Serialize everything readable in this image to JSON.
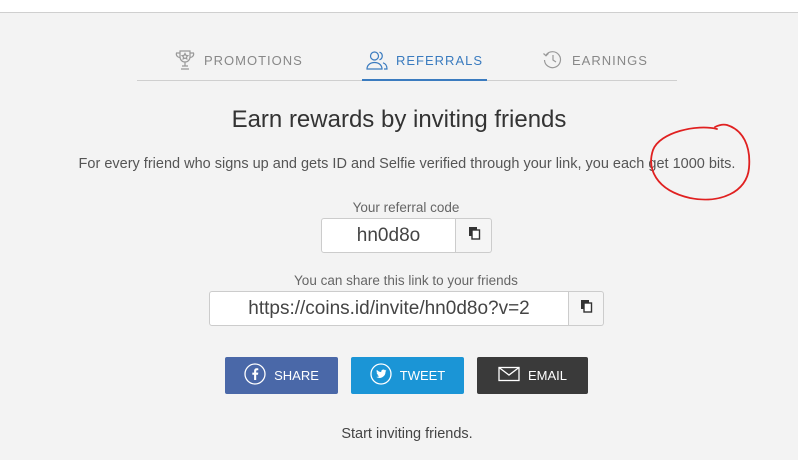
{
  "tabs": [
    {
      "label": "PROMOTIONS",
      "icon": "trophy-icon"
    },
    {
      "label": "REFERRALS",
      "icon": "users-icon",
      "active": true
    },
    {
      "label": "EARNINGS",
      "icon": "history-icon"
    }
  ],
  "main": {
    "title": "Earn rewards by inviting friends",
    "description": "For every friend who signs up and gets ID and Selfie verified through your link, you each get 1000 bits."
  },
  "referral_code": {
    "label": "Your referral code",
    "value": "hn0d8o"
  },
  "share_link": {
    "label": "You can share this link to your friends",
    "value": "https://coins.id/invite/hn0d8o?v=2"
  },
  "social": {
    "share_label": "SHARE",
    "tweet_label": "TWEET",
    "email_label": "EMAIL"
  },
  "footer": {
    "text": "Start inviting friends."
  },
  "colors": {
    "accent": "#3a7bbf",
    "facebook": "#4a68a8",
    "twitter": "#1b95d6",
    "email": "#3a3a3a",
    "annotation": "#e02020"
  }
}
